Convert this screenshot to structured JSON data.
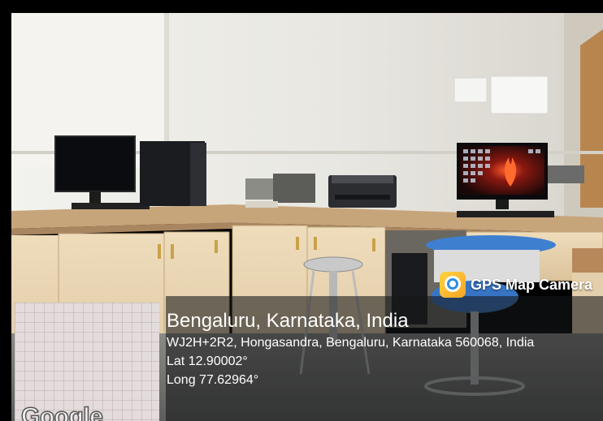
{
  "app_badge": {
    "name": "GPS Map Camera",
    "icon": "gps-map-camera-app-icon"
  },
  "location": {
    "title": "Bengaluru, Karnataka, India",
    "address": "WJ2H+2R2, Hongasandra, Bengaluru, Karnataka 560068, India",
    "latitude": "Lat 12.90002°",
    "longitude": "Long 77.62964°"
  },
  "minimap": {
    "logo": "Google"
  },
  "colors": {
    "wall": "#e9e8e2",
    "cabinet": "#e6d3b0",
    "countertop": "#c9a77a",
    "floor": "#7d7d7b",
    "stool_seat": "#3f7fd0",
    "overlay": "#141618"
  }
}
